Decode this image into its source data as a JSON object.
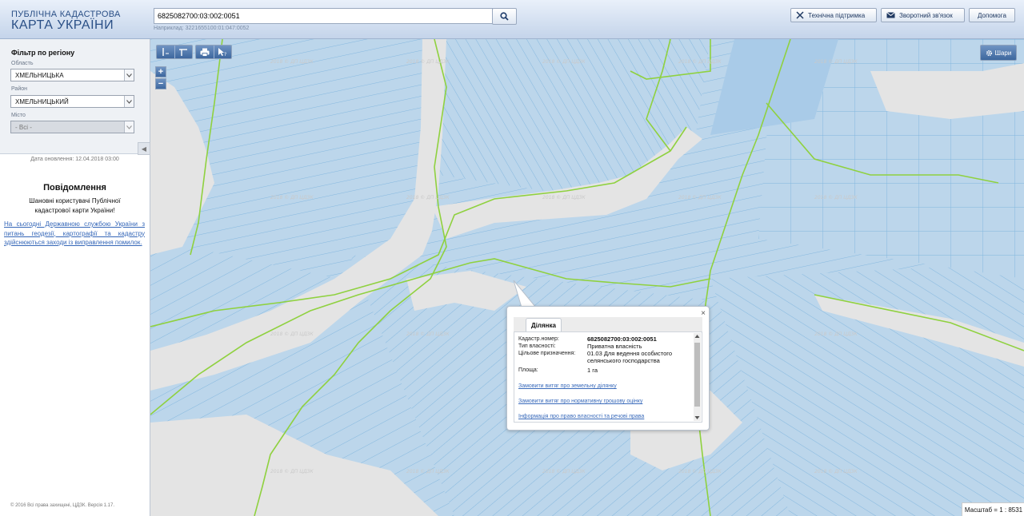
{
  "header": {
    "logo_top": "ПУБЛІЧНА КАДАСТРОВА",
    "logo_main": "КАРТА УКРАЇНИ",
    "search_value": "6825082700:03:002:0051",
    "search_hint": "Наприклад: 3221655100:01:047:0052",
    "buttons": {
      "support": "Технічна підтримка",
      "feedback": "Зворотний зв'язок",
      "help": "Допомога"
    }
  },
  "sidebar": {
    "filter_title": "Фільтр по регіону",
    "oblast_label": "Область",
    "oblast_value": "ХМЕЛЬНИЦЬКА",
    "rayon_label": "Район",
    "rayon_value": "ХМЕЛЬНИЦЬКИЙ",
    "misto_label": "Місто",
    "misto_value": "- Всі -",
    "update_date": "Дата оновлення: 12.04.2018 03:00",
    "notice_title": "Повідомлення",
    "notice_text": "Шановні користувачі Публічної кадастрової карти України!",
    "notice_link": "На сьогодні Державною службою України з питань геодезії, картографії та кадастру здійснюються заходи із виправлення помилок.",
    "copyright": "© 2016 Всі права захищені, ЦДЗК. Версія 1.17."
  },
  "map": {
    "layers_label": "Шари",
    "scale_text": "Масштаб = 1 : 8531",
    "zoom_in": "+",
    "zoom_out": "−",
    "watermark": "2018 © ДП ЦДЗК",
    "colors": {
      "parcel": "#bcd6eb",
      "parcel_line": "#7fb5de",
      "background": "#e4e4e4",
      "boundary": "#8fd13f"
    }
  },
  "popup": {
    "tab_label": "Ділянка",
    "rows": [
      {
        "label": "Кадастр.номер:",
        "value": "6825082700:03:002:0051"
      },
      {
        "label": "Тип власності:",
        "value": "Приватна власність"
      },
      {
        "label": "Цільове призначення:",
        "value": "01.03 Для ведення особистого селянського господарства"
      },
      {
        "label": "Площа:",
        "value": "1 га"
      }
    ],
    "links": [
      "Замовити витяг про земельну ділянку",
      "Замовити витяг про нормативну грошову оцінку",
      "Інформація про право власності та речові права"
    ],
    "close": "×"
  }
}
